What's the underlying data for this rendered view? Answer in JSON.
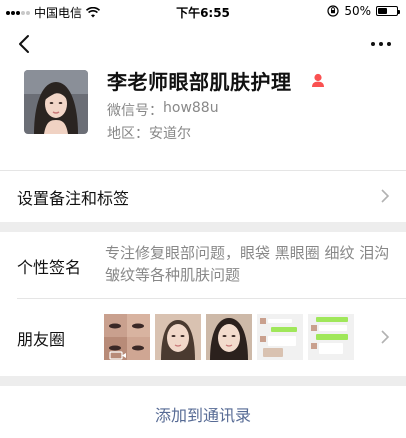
{
  "status_bar": {
    "carrier": "中国电信",
    "time": "下午6:55",
    "battery_percent": "50%",
    "battery_level": 0.5,
    "icons": [
      "signal-icon",
      "wifi-icon",
      "orientation-lock-icon",
      "battery-icon"
    ]
  },
  "nav": {
    "back_icon": "chevron-left-icon",
    "more_icon": "more-dots-icon"
  },
  "profile": {
    "name": "李老师眼部肌肤护理",
    "gender_icon": "female-icon",
    "gender_color": "#fa5151",
    "wechat_id_label": "微信号：",
    "wechat_id": "how88u",
    "region_label": "地区：",
    "region": "安道尔"
  },
  "remark": {
    "label": "设置备注和标签"
  },
  "signature": {
    "label": "个性签名",
    "text": "专注修复眼部问题，眼袋  黑眼圈  细纹  泪沟皱纹等各种肌肤问题"
  },
  "moments": {
    "label": "朋友圈",
    "thumbnails": [
      "before-after-eyes",
      "face-portrait",
      "face-portrait-2",
      "chat-screenshot",
      "chat-screenshot-2"
    ]
  },
  "add_contact": {
    "label": "添加到通讯录"
  },
  "colors": {
    "link": "#576b95",
    "background": "#ededed",
    "secondary_text": "#888888"
  }
}
